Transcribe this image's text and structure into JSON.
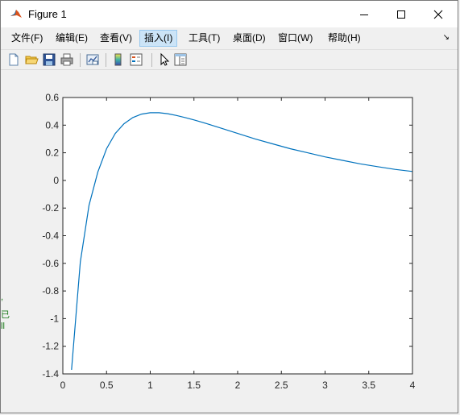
{
  "window": {
    "title": "Figure 1",
    "minimize_glyph": "—",
    "maximize_glyph": "☐",
    "close_glyph": "✕"
  },
  "menubar": {
    "items": [
      "文件(F)",
      "编辑(E)",
      "查看(V)",
      "插入(I)",
      "工具(T)",
      "桌面(D)",
      "窗口(W)",
      "帮助(H)"
    ],
    "active_index": 3,
    "overflow_glyph": "↘"
  },
  "toolbar": {
    "icons": [
      "new-figure-icon",
      "open-file-icon",
      "save-icon",
      "print-icon",
      "link-plot-icon",
      "colorbar-icon",
      "legend-icon",
      "edit-plot-arrow-icon",
      "property-inspector-icon"
    ]
  },
  "chart_data": {
    "type": "line",
    "title": "",
    "xlabel": "",
    "ylabel": "",
    "xlim": [
      0,
      4
    ],
    "ylim": [
      -1.4,
      0.6
    ],
    "xticks": [
      "0",
      "0.5",
      "1",
      "1.5",
      "2",
      "2.5",
      "3",
      "3.5",
      "4"
    ],
    "yticks": [
      "0.6",
      "0.4",
      "0.2",
      "0",
      "-0.2",
      "-0.4",
      "-0.6",
      "-0.8",
      "-1",
      "-1.2",
      "-1.4"
    ],
    "grid": false,
    "series": [
      {
        "color": "#0072bd",
        "x": [
          0.1,
          0.2,
          0.3,
          0.4,
          0.5,
          0.6,
          0.7,
          0.8,
          0.9,
          1.0,
          1.1,
          1.2,
          1.3,
          1.4,
          1.5,
          1.6,
          1.8,
          2.0,
          2.2,
          2.4,
          2.6,
          2.8,
          3.0,
          3.2,
          3.4,
          3.6,
          3.8,
          4.0
        ],
        "y": [
          -1.37,
          -0.59,
          -0.18,
          0.06,
          0.23,
          0.34,
          0.41,
          0.455,
          0.48,
          0.49,
          0.49,
          0.483,
          0.47,
          0.455,
          0.438,
          0.42,
          0.38,
          0.34,
          0.3,
          0.265,
          0.23,
          0.2,
          0.17,
          0.145,
          0.12,
          0.1,
          0.08,
          0.065
        ]
      }
    ]
  },
  "side_artifacts": [
    ",",
    "已",
    "ll"
  ]
}
